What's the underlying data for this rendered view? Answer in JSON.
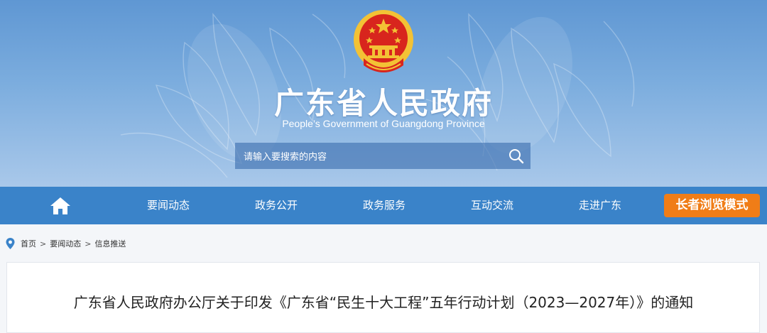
{
  "header": {
    "title": "广东省人民政府",
    "subtitle": "People’s Government of Guangdong Province",
    "emblem_icon": "national-emblem-icon"
  },
  "search": {
    "placeholder": "请输入要搜索的内容",
    "icon": "search-icon"
  },
  "nav": {
    "home_icon": "home-icon",
    "items": [
      {
        "label": "要闻动态"
      },
      {
        "label": "政务公开"
      },
      {
        "label": "政务服务"
      },
      {
        "label": "互动交流"
      },
      {
        "label": "走进广东"
      }
    ],
    "elder_mode_label": "长者浏览模式"
  },
  "breadcrumb": {
    "icon": "location-pin-icon",
    "items": [
      "首页",
      "要闻动态",
      "信息推送"
    ],
    "separator": ">"
  },
  "article": {
    "title": "广东省人民政府办公厅关于印发《广东省“民生十大工程”五年行动计划（2023—2027年）》的通知"
  },
  "colors": {
    "nav_bg": "#3a83c9",
    "elder_button": "#f07d17",
    "banner_top": "#5f97d3",
    "emblem_red": "#d8251d",
    "emblem_gold": "#f3c235"
  }
}
